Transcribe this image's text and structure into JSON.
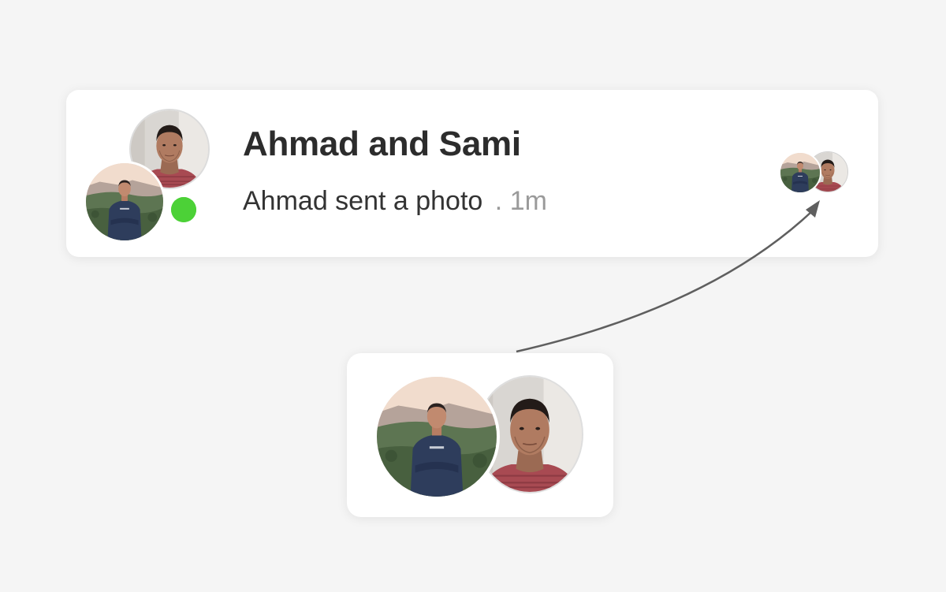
{
  "conversation": {
    "title": "Ahmad and Sami",
    "preview_text": "Ahmad sent a photo",
    "separator": ".",
    "time": "1m"
  },
  "icons": {
    "front_avatar": "person-outdoors-avatar",
    "back_avatar": "person-indoors-avatar",
    "online_indicator": "online-status-dot",
    "arrow": "curved-arrow"
  },
  "colors": {
    "background": "#f5f5f5",
    "card": "#ffffff",
    "online": "#4cd137",
    "title": "#2c2c2c",
    "meta": "#9a9a9a"
  }
}
